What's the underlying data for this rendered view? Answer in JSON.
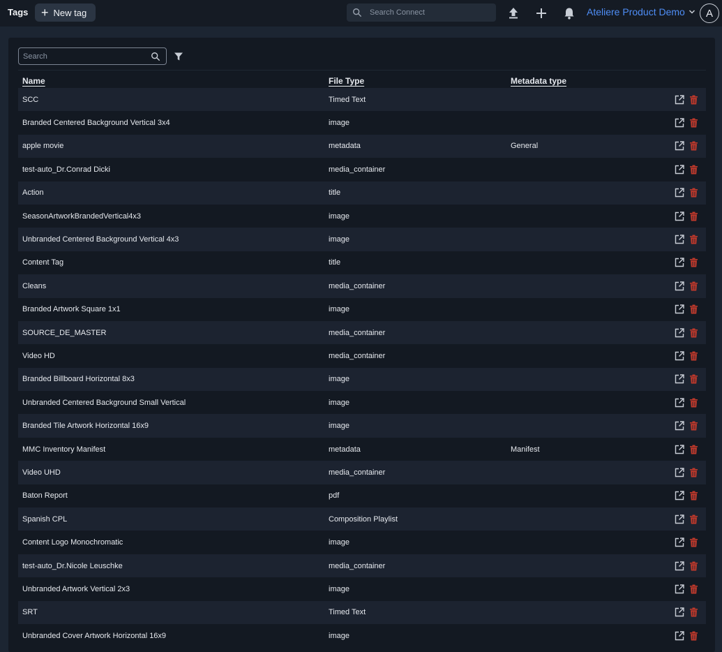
{
  "header": {
    "title": "Tags",
    "new_tag_label": "New tag",
    "search_placeholder": "Search Connect",
    "org_name": "Ateliere Product Demo",
    "avatar_initial": "A"
  },
  "filters": {
    "search_placeholder": "Search"
  },
  "table": {
    "columns": {
      "name": "Name",
      "file_type": "File Type",
      "metadata_type": "Metadata type"
    },
    "rows": [
      {
        "name": "SCC",
        "file_type": "Timed Text",
        "metadata_type": ""
      },
      {
        "name": "Branded Centered Background Vertical 3x4",
        "file_type": "image",
        "metadata_type": ""
      },
      {
        "name": "apple movie",
        "file_type": "metadata",
        "metadata_type": "General"
      },
      {
        "name": "test-auto_Dr.Conrad Dicki",
        "file_type": "media_container",
        "metadata_type": ""
      },
      {
        "name": "Action",
        "file_type": "title",
        "metadata_type": ""
      },
      {
        "name": "SeasonArtworkBrandedVertical4x3",
        "file_type": "image",
        "metadata_type": ""
      },
      {
        "name": "Unbranded Centered Background Vertical 4x3",
        "file_type": "image",
        "metadata_type": ""
      },
      {
        "name": "Content Tag",
        "file_type": "title",
        "metadata_type": ""
      },
      {
        "name": "Cleans",
        "file_type": "media_container",
        "metadata_type": ""
      },
      {
        "name": "Branded Artwork Square 1x1",
        "file_type": "image",
        "metadata_type": ""
      },
      {
        "name": "SOURCE_DE_MASTER",
        "file_type": "media_container",
        "metadata_type": ""
      },
      {
        "name": "Video HD",
        "file_type": "media_container",
        "metadata_type": ""
      },
      {
        "name": "Branded Billboard Horizontal 8x3",
        "file_type": "image",
        "metadata_type": ""
      },
      {
        "name": "Unbranded Centered Background Small Vertical",
        "file_type": "image",
        "metadata_type": ""
      },
      {
        "name": "Branded Tile Artwork Horizontal 16x9",
        "file_type": "image",
        "metadata_type": ""
      },
      {
        "name": "MMC Inventory Manifest",
        "file_type": "metadata",
        "metadata_type": "Manifest"
      },
      {
        "name": "Video UHD",
        "file_type": "media_container",
        "metadata_type": ""
      },
      {
        "name": "Baton Report",
        "file_type": "pdf",
        "metadata_type": ""
      },
      {
        "name": "Spanish CPL",
        "file_type": "Composition Playlist",
        "metadata_type": ""
      },
      {
        "name": "Content Logo Monochromatic",
        "file_type": "image",
        "metadata_type": ""
      },
      {
        "name": "test-auto_Dr.Nicole Leuschke",
        "file_type": "media_container",
        "metadata_type": ""
      },
      {
        "name": "Unbranded Artwork Vertical 2x3",
        "file_type": "image",
        "metadata_type": ""
      },
      {
        "name": "SRT",
        "file_type": "Timed Text",
        "metadata_type": ""
      },
      {
        "name": "Unbranded Cover Artwork Horizontal 16x9",
        "file_type": "image",
        "metadata_type": ""
      }
    ]
  },
  "colors": {
    "accent": "#4e8df5",
    "delete": "#c0392b",
    "background": "#1c2532"
  },
  "icons": [
    "search-icon",
    "upload-icon",
    "plus-icon",
    "bell-icon",
    "chevron-down-icon",
    "filter-icon",
    "open-external-icon",
    "trash-icon"
  ]
}
